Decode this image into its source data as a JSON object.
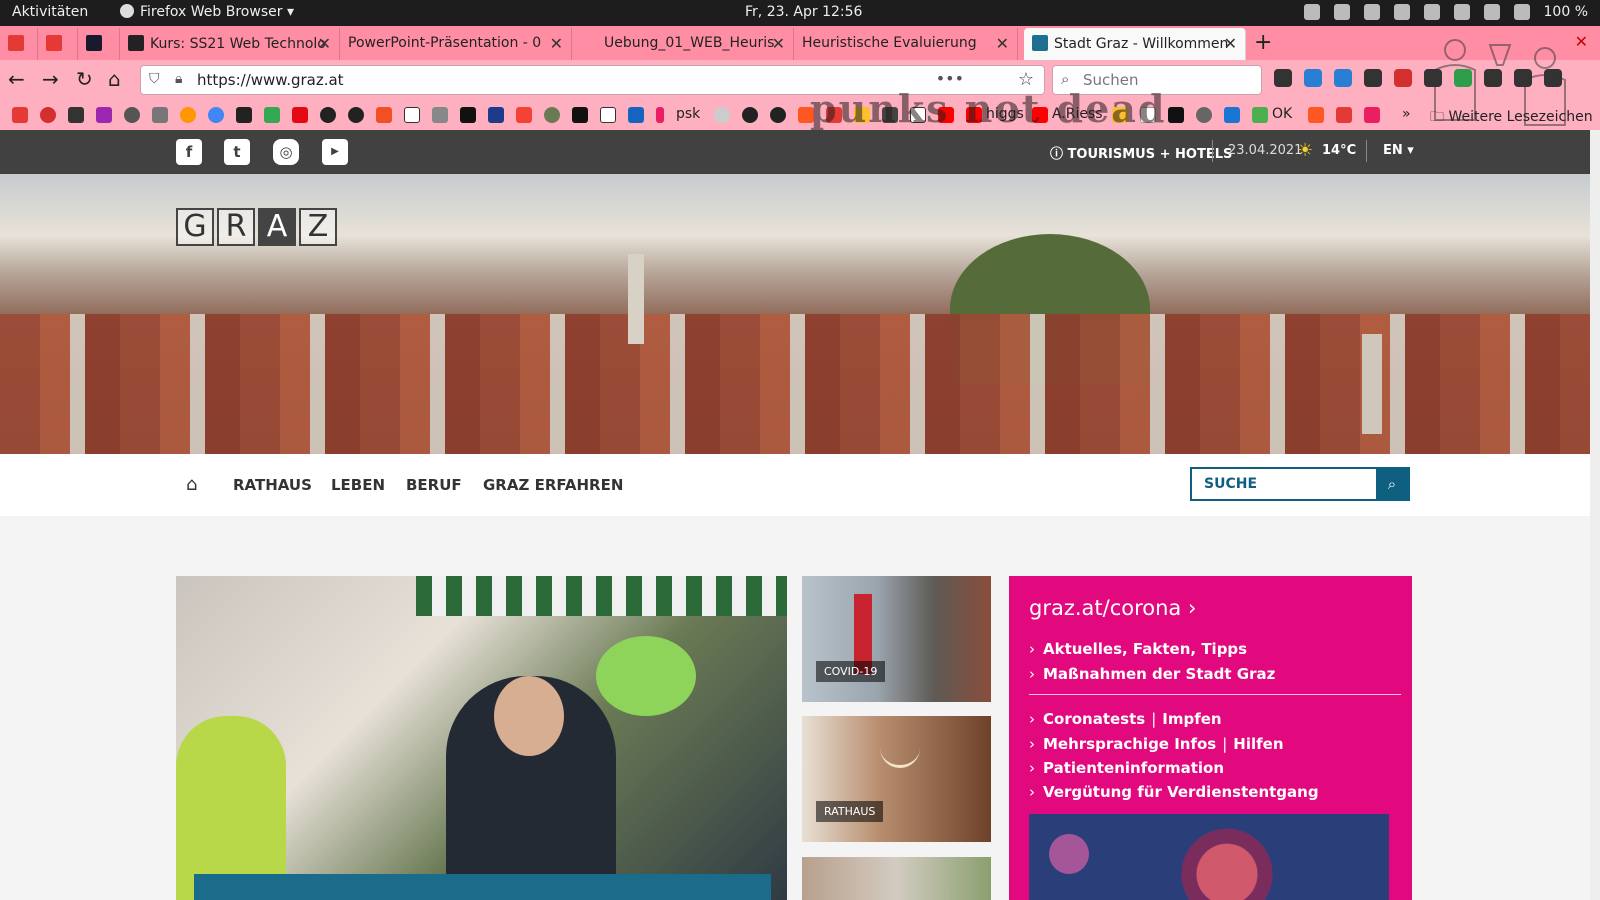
{
  "topbar": {
    "activities": "Aktivitäten",
    "app_name": "Firefox Web Browser",
    "clock": "Fr, 23. Apr  12:56",
    "battery": "100 %"
  },
  "tabs": [
    {
      "label": "",
      "favicon_color": "#e53935"
    },
    {
      "label": "",
      "favicon_color": "#e53935"
    },
    {
      "label": "",
      "favicon_color": "#1a1a2e"
    },
    {
      "label": "Kurs: SS21 Web Technolo",
      "favicon_color": "#222222"
    },
    {
      "label": "PowerPoint-Präsentation - 0",
      "favicon_color": ""
    },
    {
      "label": "Uebung_01_WEB_Heuris",
      "favicon_color": ""
    },
    {
      "label": "Heuristische Evaluierung",
      "favicon_color": ""
    },
    {
      "label": "Stadt Graz - Willkommen",
      "favicon_color": "#1f6e93",
      "active": true
    }
  ],
  "navbar": {
    "url": "https://www.graz.at",
    "search_placeholder": "Suchen"
  },
  "bookmarks": {
    "psk": "psk",
    "higgs": "higgs",
    "a_riess": "A.Riess",
    "ok": "OK",
    "more": "Weitere Lesezeichen"
  },
  "overlay_text": "punks not dead",
  "site": {
    "topbar": {
      "tourism": "TOURISMUS + HOTELS",
      "date": "23.04.2021",
      "temperature": "14°C",
      "language": "EN"
    },
    "logo_letters": [
      "G",
      "R",
      "A",
      "Z"
    ],
    "nav": [
      "RATHAUS",
      "LEBEN",
      "BERUF",
      "GRAZ ERFAHREN"
    ],
    "search_placeholder": "SUCHE",
    "thumbs": [
      "COVID-19",
      "RATHAUS"
    ],
    "corona": {
      "title": "graz.at/corona",
      "links": [
        "Aktuelles, Fakten, Tipps",
        "Maßnahmen der Stadt Graz"
      ],
      "links2": [
        {
          "a": "Coronatests",
          "b": "Impfen"
        },
        {
          "a": "Mehrsprachige Infos",
          "b": "Hilfen"
        }
      ],
      "links3": [
        "Patienteninformation",
        "Vergütung für Verdienstentgang"
      ]
    }
  }
}
